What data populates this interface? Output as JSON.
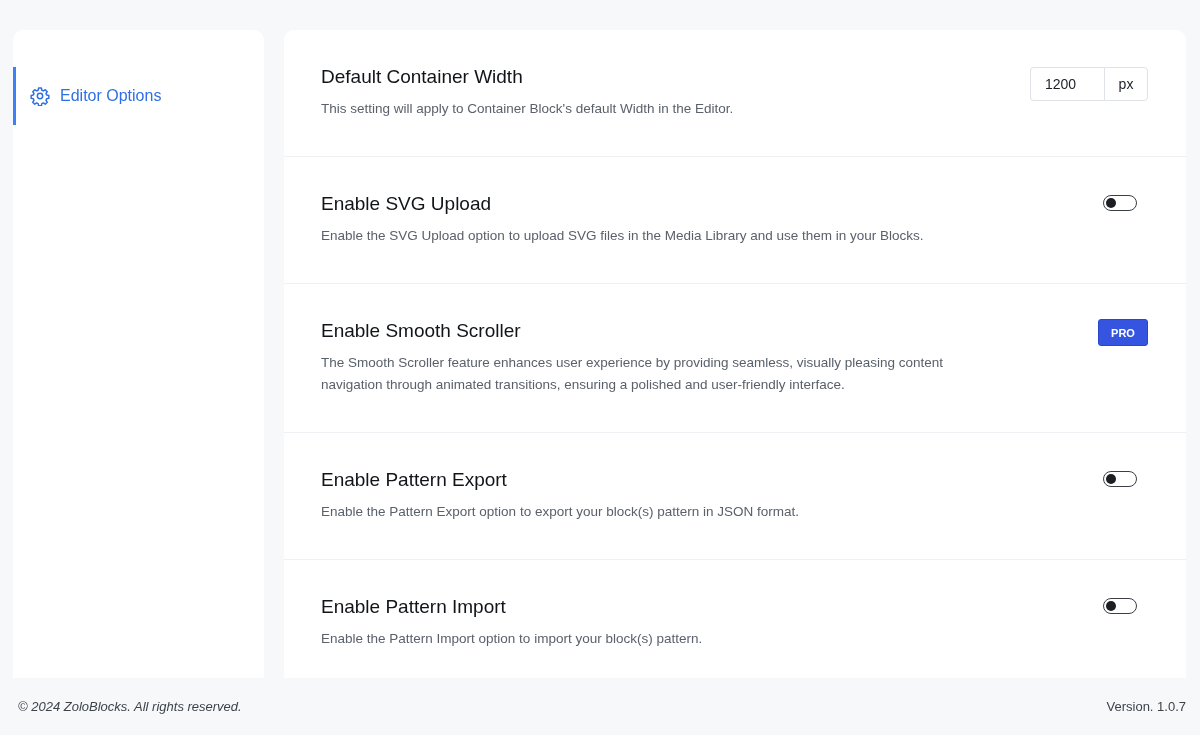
{
  "sidebar": {
    "items": [
      {
        "label": "Editor Options",
        "selected": true
      }
    ]
  },
  "settings": [
    {
      "kind": "number",
      "title": "Default Container Width",
      "description": "This setting will apply to Container Block's default Width in the Editor.",
      "value": "1200",
      "unit": "px"
    },
    {
      "kind": "toggle",
      "title": "Enable SVG Upload",
      "description": "Enable the SVG Upload option to upload SVG files in the Media Library and use them in your Blocks.",
      "on": false
    },
    {
      "kind": "pro",
      "title": "Enable Smooth Scroller",
      "description": "The Smooth Scroller feature enhances user experience by providing seamless, visually pleasing content navigation through animated transitions, ensuring a polished and user-friendly interface.",
      "badge": "PRO"
    },
    {
      "kind": "toggle",
      "title": "Enable Pattern Export",
      "description": "Enable the Pattern Export option to export your block(s) pattern in JSON format.",
      "on": false
    },
    {
      "kind": "toggle",
      "title": "Enable Pattern Import",
      "description": "Enable the Pattern Import option to import your block(s) pattern.",
      "on": false
    }
  ],
  "footer": {
    "copyright": "© 2024 ZoloBlocks. All rights reserved.",
    "version": "Version. 1.0.7"
  }
}
